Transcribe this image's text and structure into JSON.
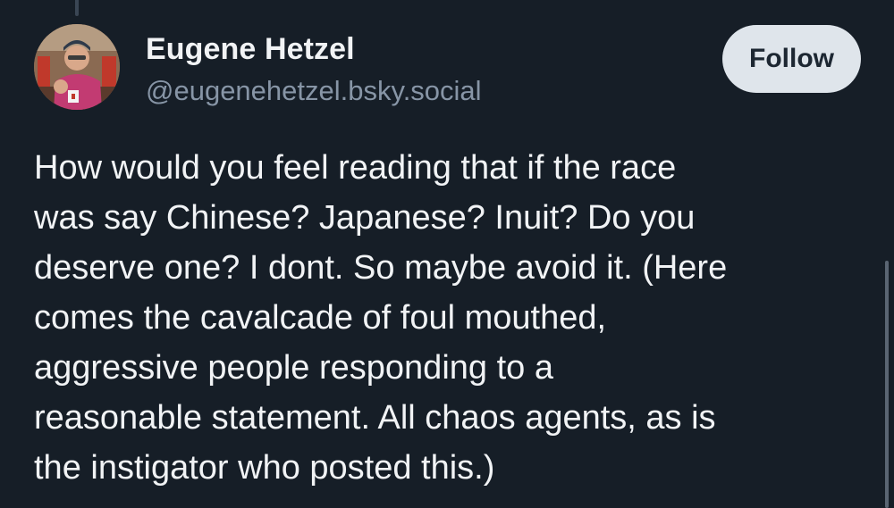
{
  "post": {
    "author": {
      "display_name": "Eugene Hetzel",
      "handle": "@eugenehetzel.bsky.social",
      "avatar_icon": "user-avatar-photo"
    },
    "follow_label": "Follow",
    "body_lines": [
      "How would you feel reading that if the race",
      "was say Chinese? Japanese? Inuit? Do you",
      "deserve one? I dont. So maybe avoid it. (Here",
      "comes the cavalcade of foul mouthed,",
      "aggressive people responding to a",
      "reasonable statement. All chaos agents, as is",
      "the instigator who posted this.)"
    ]
  },
  "colors": {
    "background": "#161e27",
    "text": "#f1f3f5",
    "muted": "#8795a6",
    "follow_bg": "#dfe5eb"
  }
}
